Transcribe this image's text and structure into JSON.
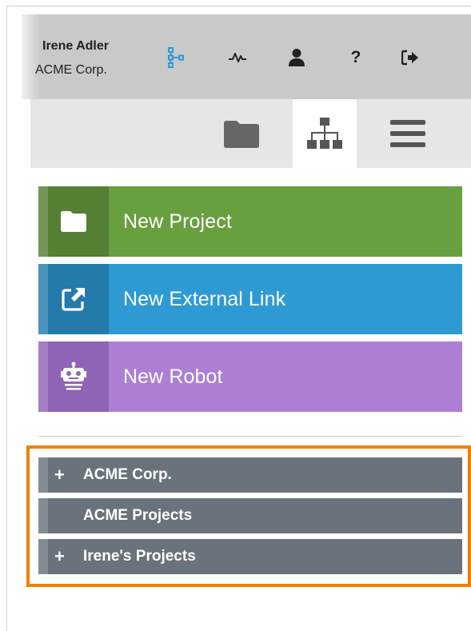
{
  "user": {
    "name": "Irene Adler",
    "org": "ACME Corp."
  },
  "header_icons": [
    "workflow-icon",
    "activity-icon",
    "user-icon",
    "help-icon",
    "sign-out-icon"
  ],
  "tabs": [
    {
      "icon": "folder-icon",
      "active": false
    },
    {
      "icon": "sitemap-icon",
      "active": true
    },
    {
      "icon": "menu-icon",
      "active": false
    }
  ],
  "actions": {
    "new_project": {
      "label": "New Project",
      "icon": "folder-icon",
      "color": "#689f3f"
    },
    "new_external_link": {
      "label": "New External Link",
      "icon": "external-link-icon",
      "color": "#2d9ad4"
    },
    "new_robot": {
      "label": "New Robot",
      "icon": "robot-icon",
      "color": "#ad7fd4"
    }
  },
  "tree": {
    "items": [
      {
        "label": "ACME Corp.",
        "expandable": true
      },
      {
        "label": "ACME Projects",
        "expandable": false
      },
      {
        "label": "Irene's Projects",
        "expandable": true
      }
    ],
    "highlight_color": "#f07f09"
  }
}
